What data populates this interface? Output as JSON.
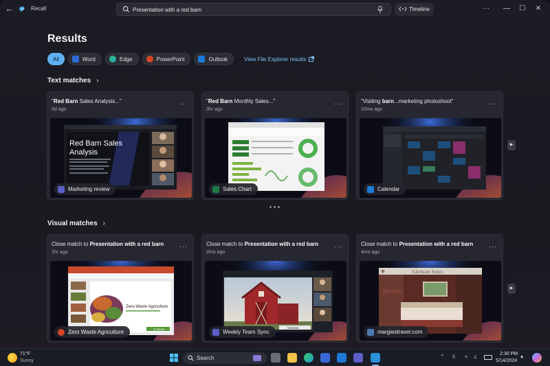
{
  "window": {
    "app_title": "Recall",
    "search_value": "Presentation with a red barn",
    "timeline_label": "Timeline",
    "more_label": "···",
    "minimize_label": "—",
    "maximize_label": "☐",
    "close_label": "✕"
  },
  "results": {
    "title": "Results",
    "filters": [
      {
        "label": "All",
        "active": true
      },
      {
        "label": "Word",
        "icon": "word-icon",
        "color": "#2b6cd6"
      },
      {
        "label": "Edge",
        "icon": "edge-icon",
        "color": "#1fa0c9"
      },
      {
        "label": "PowerPoint",
        "icon": "powerpoint-icon",
        "color": "#d24726"
      },
      {
        "label": "Outlook",
        "icon": "outlook-icon",
        "color": "#1c7ad6"
      }
    ],
    "file_explorer_link": "View File Explorer results"
  },
  "text_matches": {
    "title": "Text matches",
    "cards": [
      {
        "prefix": "\"",
        "bold": "Red Barn",
        "suffix": " Sales Analysis...\"",
        "time": "5d ago",
        "badge": "Marketing review",
        "badge_icon": "teams-icon",
        "thumb_text": "Red Barn Sales Analysis"
      },
      {
        "prefix": "\"",
        "bold": "Red Barn",
        "suffix": " Monthly Sales...\"",
        "time": "3hr ago",
        "badge": "Sales Chart",
        "badge_icon": "excel-icon"
      },
      {
        "prefix": "\"Visiting ",
        "bold": "barn",
        "suffix": "...marketing photoshoot\"",
        "time": "10mo ago",
        "badge": "Calendar",
        "badge_icon": "calendar-icon"
      }
    ]
  },
  "visual_matches": {
    "title": "Visual matches",
    "cards": [
      {
        "prefix": "Close match to ",
        "bold": "Presentation with a red barn",
        "time": "1hr ago",
        "badge": "Zero Waste Agriculture",
        "badge_icon": "powerpoint-icon",
        "thumb_text": "Zero-Waste Agriculture",
        "thumb_brand": "Contoso"
      },
      {
        "prefix": "Close match to ",
        "bold": "Presentation with a red barn",
        "time": "2mo ago",
        "badge": "Weekly Team Sync",
        "badge_icon": "teams-icon",
        "thumb_brand": "Contoso"
      },
      {
        "prefix": "Close match to ",
        "bold": "Presentation with a red barn",
        "time": "4mo ago",
        "badge": "margiestravel.com",
        "badge_icon": "web-icon",
        "thumb_text": "Fabrikam Suites"
      }
    ]
  },
  "taskbar": {
    "weather_temp": "71°F",
    "weather_desc": "Sunny",
    "search_label": "Search",
    "time": "2:30 PM",
    "date": "5/14/2024"
  }
}
